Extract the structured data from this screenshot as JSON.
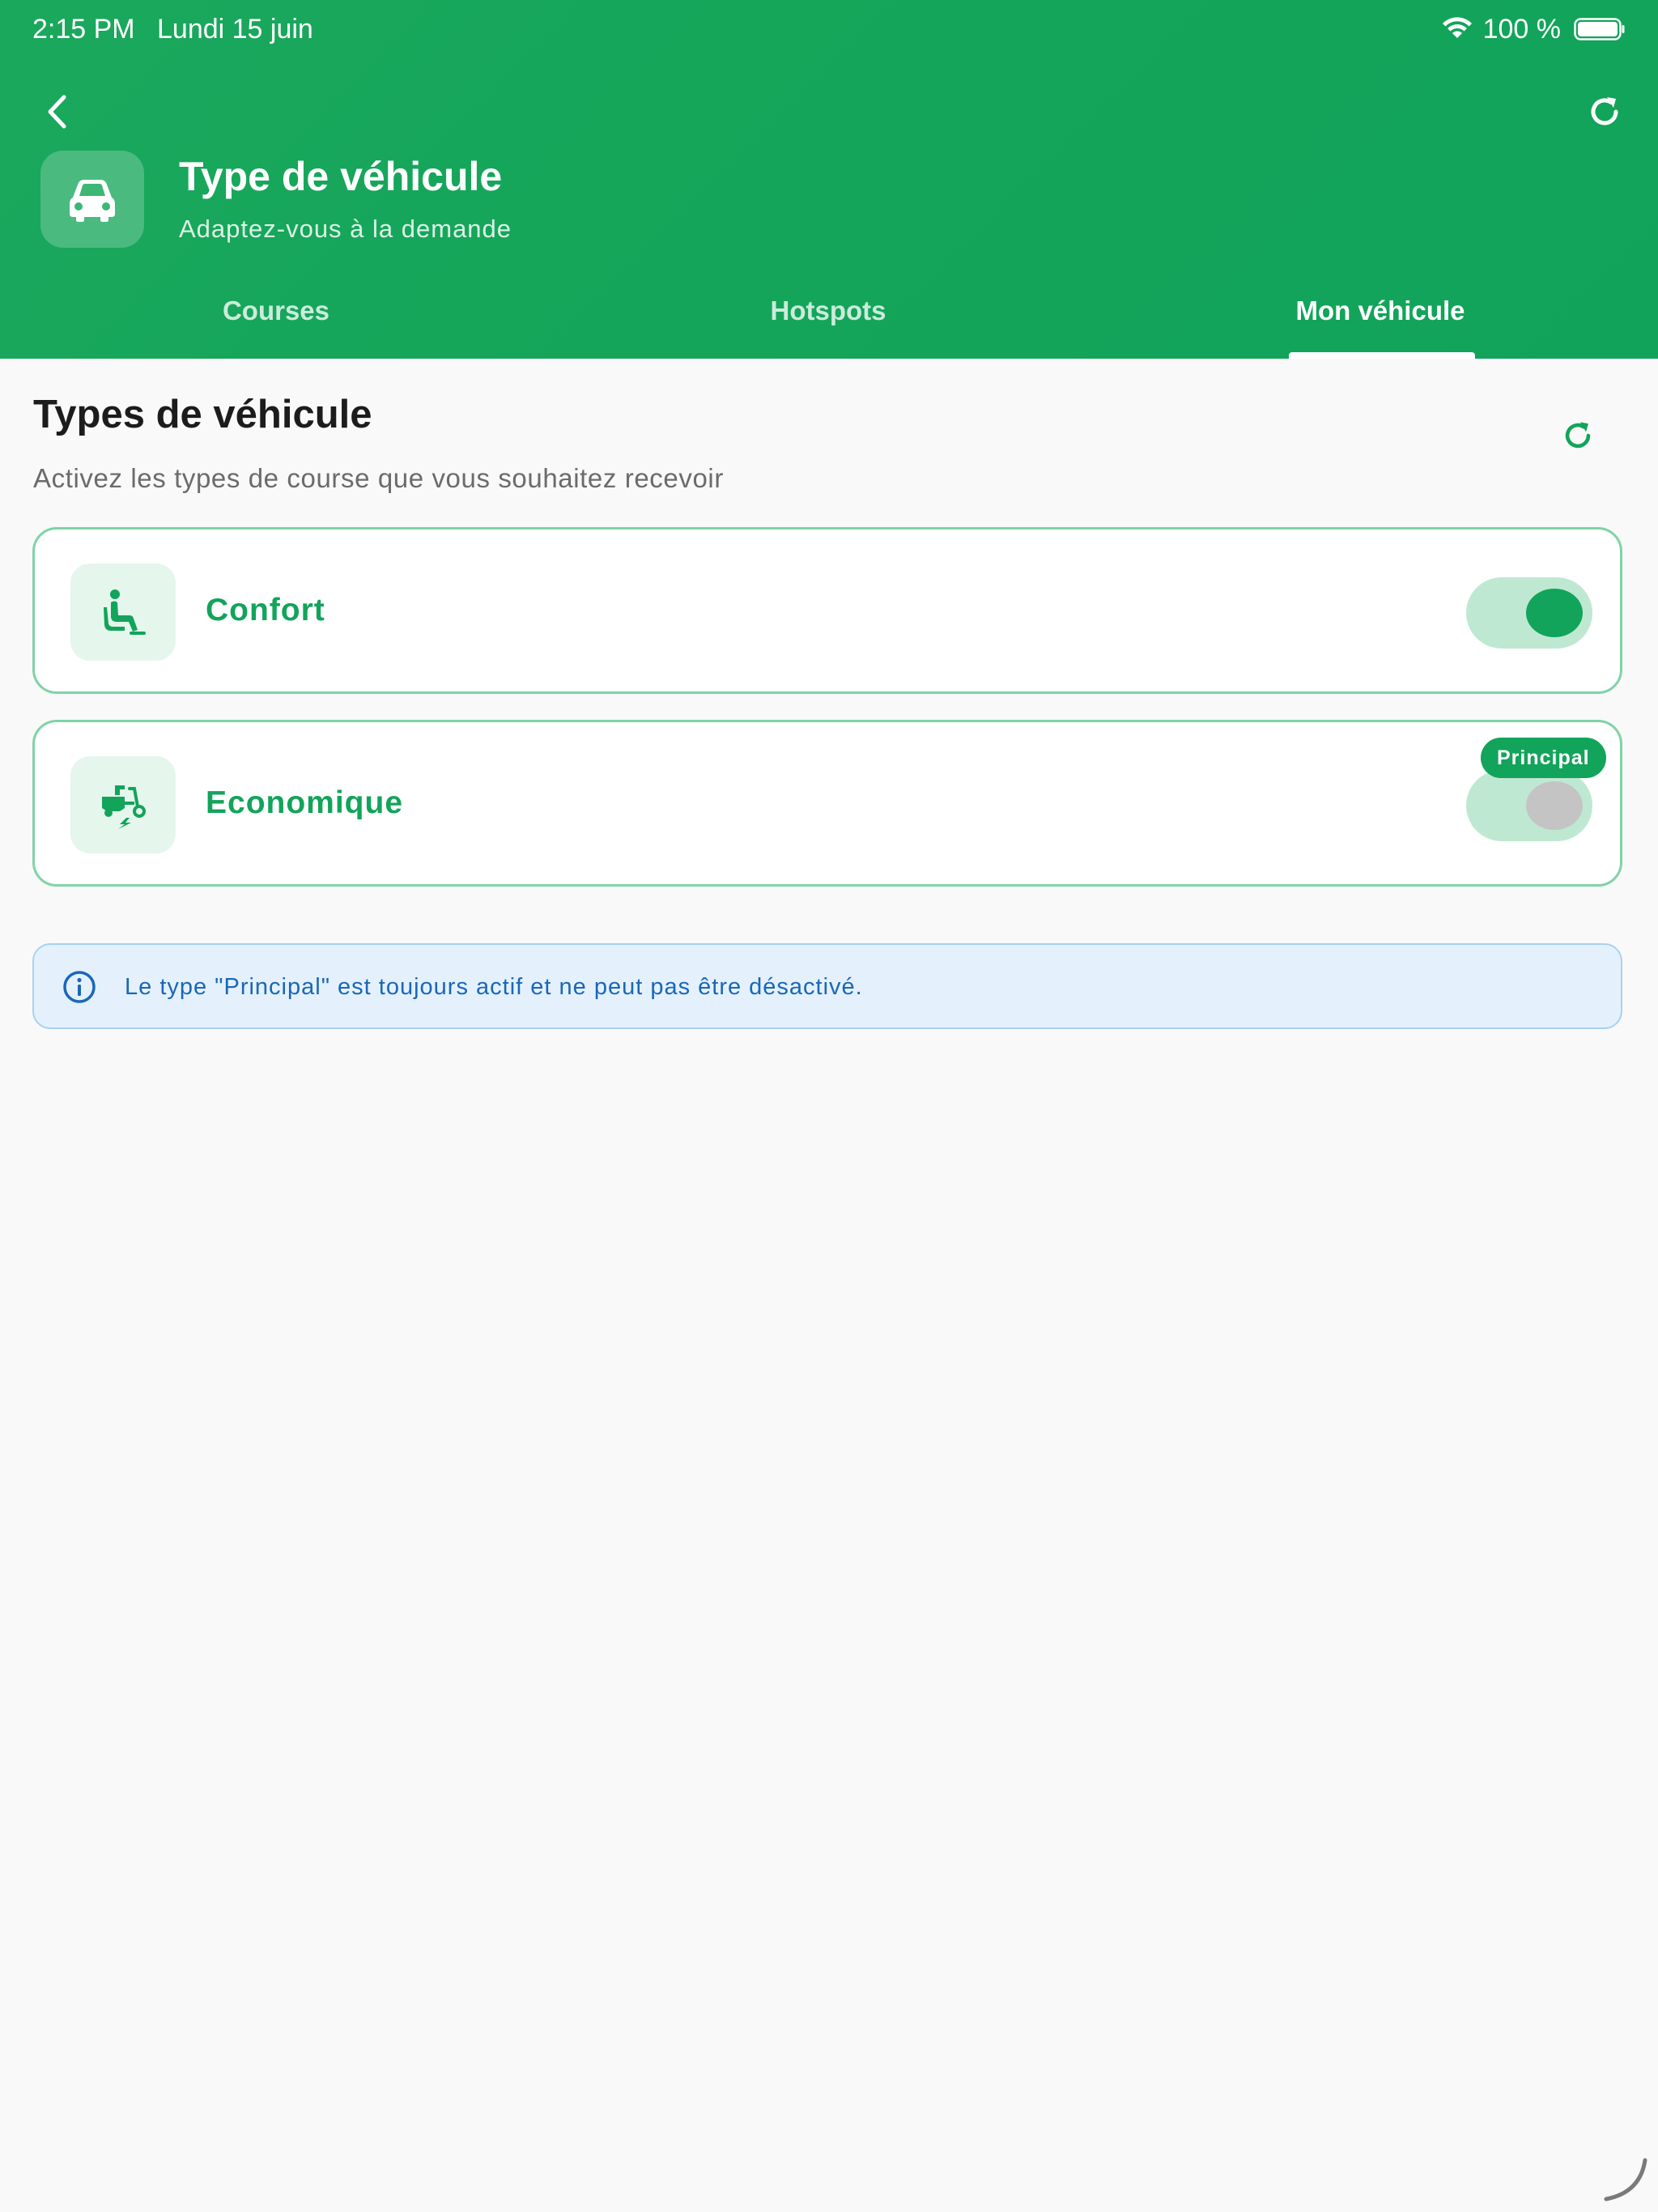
{
  "status_bar": {
    "time": "2:15 PM",
    "date": "Lundi 15 juin",
    "battery": "100 %",
    "icons": [
      "wifi-icon",
      "battery-icon"
    ]
  },
  "header": {
    "title": "Type de véhicule",
    "subtitle": "Adaptez-vous à la demande",
    "icon": "car-icon",
    "back_icon": "chevron-left-icon",
    "refresh_icon": "refresh-icon",
    "background_color": "#14a55a"
  },
  "tabs": [
    {
      "label": "Courses",
      "active": false
    },
    {
      "label": "Hotspots",
      "active": false
    },
    {
      "label": "Mon véhicule",
      "active": true
    }
  ],
  "section": {
    "title": "Types de véhicule",
    "subtitle": "Activez les types de course que vous souhaitez recevoir",
    "refresh_icon": "refresh-icon"
  },
  "vehicle_types": [
    {
      "label": "Confort",
      "icon": "comfort-seat-icon",
      "enabled": true,
      "badge": ""
    },
    {
      "label": "Economique",
      "icon": "scooter-icon",
      "enabled": false,
      "badge": "Principal"
    }
  ],
  "info": {
    "text": "Le type \"Principal\" est toujours actif et ne peut pas être désactivé.",
    "icon": "info-icon"
  },
  "colors": {
    "accent": "#12a45a",
    "card_border": "#7fd3a7",
    "toggle_track": "#bfe8d2",
    "info_background": "#e4f1fc",
    "info_text": "#1a67b8"
  }
}
